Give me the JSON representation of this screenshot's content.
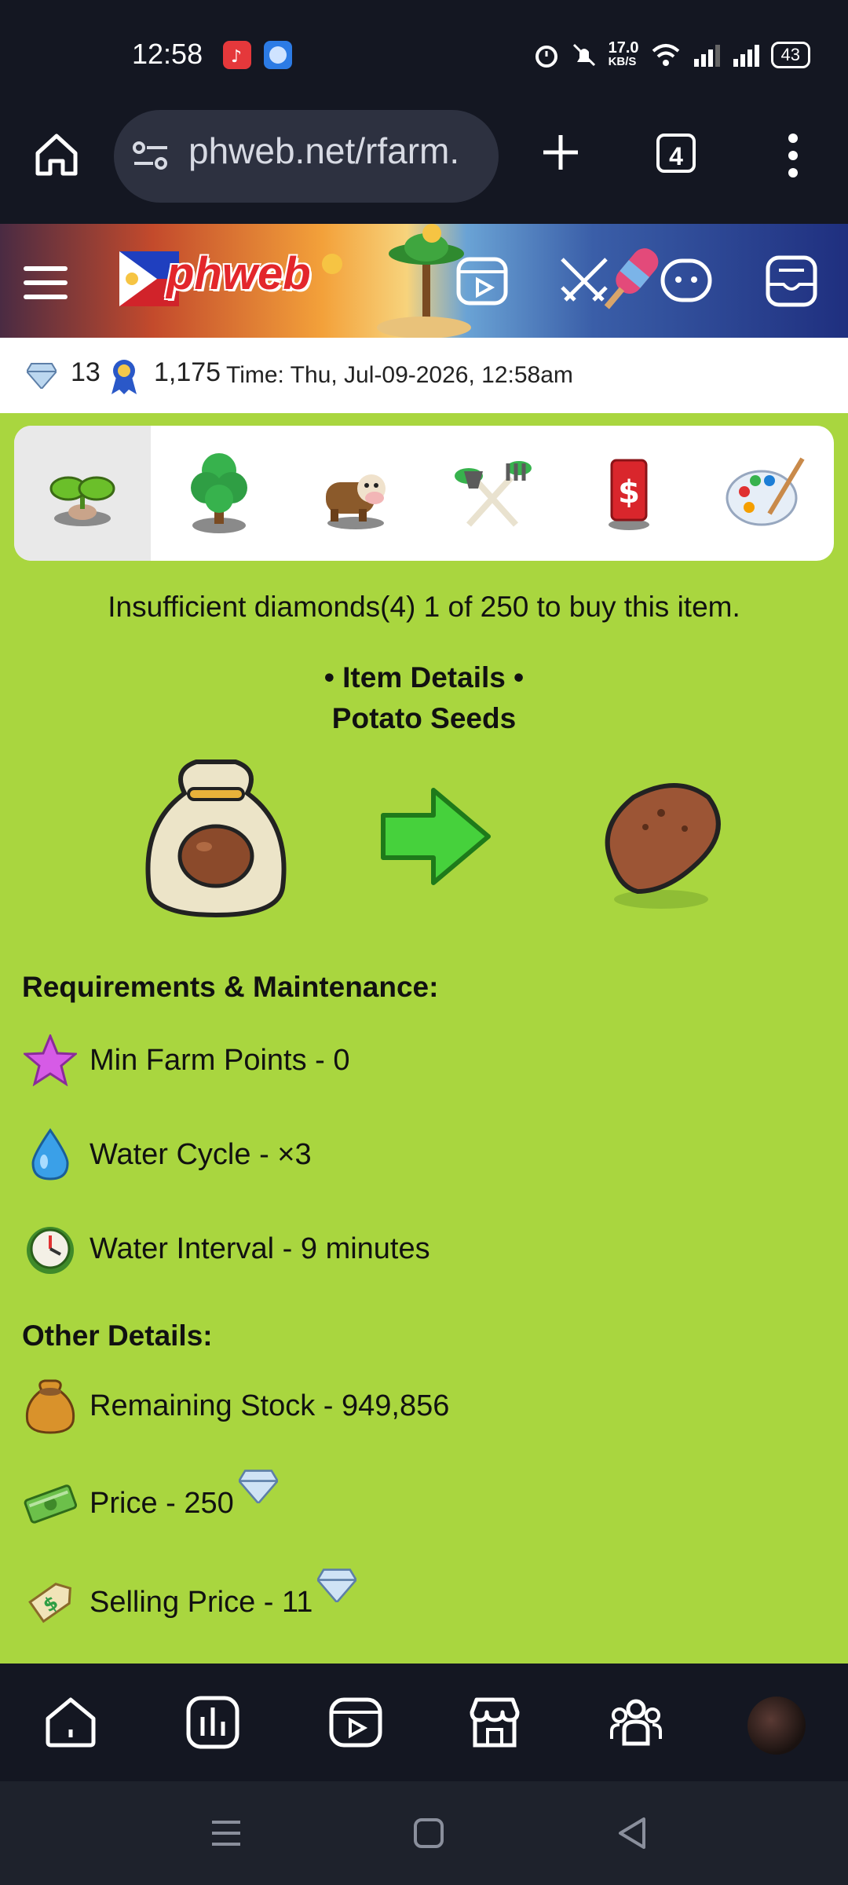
{
  "status_bar": {
    "time": "12:58",
    "net_speed_value": "17.0",
    "net_speed_unit": "KB/S",
    "battery": "43"
  },
  "browser": {
    "url": "phweb.net/rfarm.",
    "tab_count": "4"
  },
  "banner": {
    "logo_text": "phweb"
  },
  "stats": {
    "diamonds": "13",
    "points": "1,175",
    "time_label": "Time: Thu, Jul-09-2026, 12:58am"
  },
  "categories": [
    {
      "name": "seeds",
      "icon": "sprout-icon",
      "active": true
    },
    {
      "name": "trees",
      "icon": "tree-icon",
      "active": false
    },
    {
      "name": "animals",
      "icon": "cow-icon",
      "active": false
    },
    {
      "name": "tools",
      "icon": "shovel-fork-icon",
      "active": false
    },
    {
      "name": "shop",
      "icon": "dollar-card-icon",
      "active": false
    },
    {
      "name": "decor",
      "icon": "palette-icon",
      "active": false
    }
  ],
  "message": "Insufficient diamonds(4) 1 of 250 to buy this item.",
  "item": {
    "details_title": "• Item Details •",
    "name": "Potato Seeds"
  },
  "requirements": {
    "heading": "Requirements & Maintenance:",
    "rows": [
      {
        "icon": "star-icon",
        "label": "Min Farm Points - 0"
      },
      {
        "icon": "water-drop-icon",
        "label": "Water Cycle - ×3"
      },
      {
        "icon": "clock-icon",
        "label": "Water Interval - 9 minutes"
      }
    ]
  },
  "other": {
    "heading": "Other Details:",
    "rows": [
      {
        "icon": "money-bag-icon",
        "label": "Remaining Stock - 949,856"
      },
      {
        "icon": "cash-icon",
        "label": "Price - 250"
      },
      {
        "icon": "price-tag-icon",
        "label": "Selling Price - 11"
      }
    ]
  },
  "colors": {
    "background": "#a9d63f",
    "dark_bar": "#141722"
  }
}
